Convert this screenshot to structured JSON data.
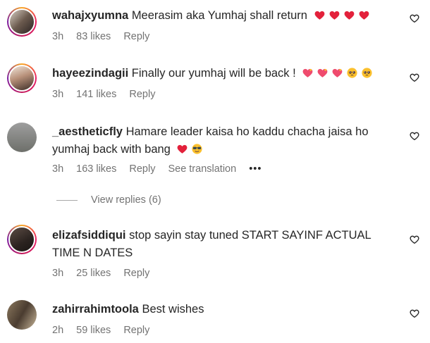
{
  "comments": [
    {
      "username": "wahajxyumna",
      "text": "Meerasim aka Yumhaj shall return",
      "time": "3h",
      "likes": "83 likes",
      "reply": "Reply",
      "emojis": [
        "heart",
        "heart",
        "heart",
        "heart"
      ]
    },
    {
      "username": "hayeezindagii",
      "text": "Finally our yumhaj will be back !",
      "time": "3h",
      "likes": "141 likes",
      "reply": "Reply",
      "emojis": [
        "heart-sparkle",
        "heart-sparkle",
        "heart-sparkle",
        "pleading-face",
        "pleading-face"
      ]
    },
    {
      "username": "_aestheticfly",
      "text_line1": "Hamare leader kaisa ho kaddu chacha jaisa ho",
      "text_line2": "yumhaj back with bang",
      "time": "3h",
      "likes": "163 likes",
      "reply": "Reply",
      "see_translation": "See translation",
      "more": "•••",
      "emojis": [
        "heart",
        "sunglasses-face"
      ]
    },
    {
      "view_replies": "View replies (6)"
    },
    {
      "username": "elizafsiddiqui",
      "text_line1": "stop sayin stay tuned START SAYINF ACTUAL",
      "text_line2": "TIME N DATES",
      "time": "3h",
      "likes": "25 likes",
      "reply": "Reply"
    },
    {
      "username": "zahirrahimtoola",
      "text": "Best wishes",
      "time": "2h",
      "likes": "59 likes",
      "reply": "Reply"
    }
  ],
  "colors": {
    "heart": "#e3213b",
    "meta": "#737373",
    "text": "#262626"
  }
}
